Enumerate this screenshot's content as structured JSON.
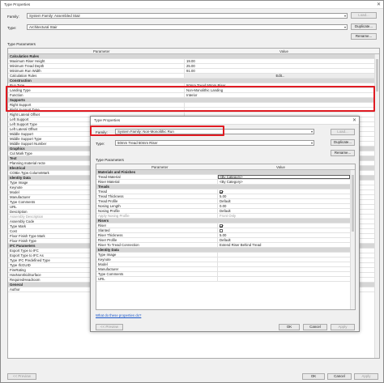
{
  "outer": {
    "title": "Type Properties",
    "family_label": "Family:",
    "family_value": "System Family: Assembled Stair",
    "type_label": "Type:",
    "type_value": "Architectural Stair",
    "load_btn": "Load...",
    "duplicate_btn": "Duplicate...",
    "rename_btn": "Rename...",
    "type_params_label": "Type Parameters",
    "col_param": "Parameter",
    "col_value": "Value",
    "rows": [
      {
        "k": "group",
        "p": "Calculation Rules"
      },
      {
        "p": "Maximum Riser Height",
        "v": "19.00"
      },
      {
        "p": "Minimum Tread Depth",
        "v": "25.00"
      },
      {
        "p": "Minimum Run Width",
        "v": "91.00"
      },
      {
        "p": "Calculation Rules",
        "v": "Edit...",
        "btn": true
      },
      {
        "k": "group",
        "p": "Construction"
      },
      {
        "p": "Run Type",
        "v": "50mm Tread 50mm Riser"
      },
      {
        "p": "Landing Type",
        "v": "Non-Monolithic Landing"
      },
      {
        "p": "Function",
        "v": "Interior"
      },
      {
        "k": "group",
        "p": "Supports"
      },
      {
        "p": "Right Support",
        "v": ""
      },
      {
        "p": "Right Support Type",
        "v": ""
      },
      {
        "p": "Right Lateral Offset",
        "v": ""
      },
      {
        "p": "Left Support",
        "v": ""
      },
      {
        "p": "Left Support Type",
        "v": ""
      },
      {
        "p": "Left Lateral Offset",
        "v": ""
      },
      {
        "p": "Middle Support",
        "v": ""
      },
      {
        "p": "Middle Support Type",
        "v": ""
      },
      {
        "p": "Middle Support Number",
        "v": ""
      },
      {
        "k": "group",
        "p": "Graphics"
      },
      {
        "p": "Cut Mark Type",
        "v": ""
      },
      {
        "k": "group",
        "p": "Text"
      },
      {
        "p": "Planning material recte",
        "v": ""
      },
      {
        "k": "group",
        "p": "Electrical"
      },
      {
        "p": "COBie.Type.ColumnMark",
        "v": ""
      },
      {
        "k": "group",
        "p": "Identity Data"
      },
      {
        "p": "Type Image",
        "v": ""
      },
      {
        "p": "Keynote",
        "v": ""
      },
      {
        "p": "Model",
        "v": ""
      },
      {
        "p": "Manufacturer",
        "v": ""
      },
      {
        "p": "Type Comments",
        "v": ""
      },
      {
        "p": "URL",
        "v": ""
      },
      {
        "p": "Description",
        "v": ""
      },
      {
        "p": "Assembly Description",
        "v": "",
        "grey": true
      },
      {
        "p": "Assembly Code",
        "v": ""
      },
      {
        "p": "Type Mark",
        "v": ""
      },
      {
        "p": "Cost",
        "v": ""
      },
      {
        "p": "Floor Finish Type Mark",
        "v": ""
      },
      {
        "p": "Floor Finish Type",
        "v": ""
      },
      {
        "k": "group",
        "p": "IFC Parameters"
      },
      {
        "p": "Export Type to IFC",
        "v": ""
      },
      {
        "p": "Export Type to IFC As",
        "v": ""
      },
      {
        "p": "Type IFC Predefined Type",
        "v": ""
      },
      {
        "p": "Type IfcGUID",
        "v": ""
      },
      {
        "p": "FireRating",
        "v": ""
      },
      {
        "p": "HasNonSkidSurface",
        "v": ""
      },
      {
        "p": "RequiredHeadroom",
        "v": ""
      },
      {
        "k": "group",
        "p": "General"
      },
      {
        "p": "Author",
        "v": ""
      }
    ],
    "preview_btn": "<< Preview",
    "ok_btn": "OK",
    "cancel_btn": "Cancel",
    "apply_btn": "Apply"
  },
  "inner": {
    "title": "Type Properties",
    "family_label": "Family:",
    "family_value": "System Family: Non-Monolithic Run",
    "type_label": "Type:",
    "type_value": "50mm Tread 50mm Riser",
    "load_btn": "Load...",
    "duplicate_btn": "Duplicate...",
    "rename_btn": "Rename...",
    "type_params_label": "Type Parameters",
    "col_param": "Parameter",
    "col_value": "Value",
    "rows": [
      {
        "k": "group",
        "p": "Materials and Finishes"
      },
      {
        "p": "Tread Material",
        "v": "<By Category>",
        "sel": true
      },
      {
        "p": "Riser Material",
        "v": "<By Category>"
      },
      {
        "k": "group",
        "p": "Treads"
      },
      {
        "p": "Tread",
        "cb": "on"
      },
      {
        "p": "Tread Thickness",
        "v": "5.00"
      },
      {
        "p": "Tread Profile",
        "v": "Default"
      },
      {
        "p": "Nosing Length",
        "v": "0.00"
      },
      {
        "p": "Nosing Profile",
        "v": "Default"
      },
      {
        "p": "Apply Nosing Profile",
        "v": "Front Only",
        "grey": true
      },
      {
        "k": "group",
        "p": "Risers"
      },
      {
        "p": "Riser",
        "cb": "on"
      },
      {
        "p": "Slanted",
        "cb": "off"
      },
      {
        "p": "Riser Thickness",
        "v": "5.00"
      },
      {
        "p": "Riser Profile",
        "v": "Default"
      },
      {
        "p": "Riser To Tread Connection",
        "v": "Extend Riser Behind Tread"
      },
      {
        "k": "group",
        "p": "Identity Data"
      },
      {
        "p": "Type Image",
        "v": ""
      },
      {
        "p": "Keynote",
        "v": ""
      },
      {
        "p": "Model",
        "v": ""
      },
      {
        "p": "Manufacturer",
        "v": ""
      },
      {
        "p": "Type Comments",
        "v": ""
      },
      {
        "p": "URL",
        "v": ""
      }
    ],
    "help_link": "What do these properties do?",
    "preview_btn": "<< Preview",
    "ok_btn": "OK",
    "cancel_btn": "Cancel",
    "apply_btn": "Apply"
  },
  "colors": {
    "highlight": "#e01b22",
    "group": "#d6d6d6",
    "link": "#1a56c9"
  }
}
